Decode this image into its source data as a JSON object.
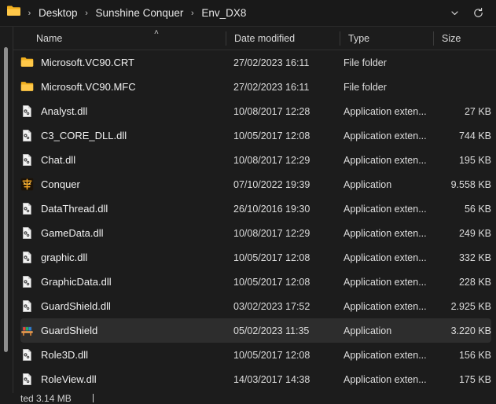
{
  "window": {
    "background_color": "#1c1c1c",
    "selection_color": "#2d2d2d",
    "folder_icon_color": "#ffc849"
  },
  "addressbar": {
    "folder_icon": "folder-icon",
    "crumbs": [
      {
        "label": "Desktop"
      },
      {
        "label": "Sunshine Conquer"
      },
      {
        "label": "Env_DX8"
      }
    ],
    "separator": "›",
    "dropdown_icon": "chevron-down-icon",
    "refresh_icon": "refresh-icon"
  },
  "columns": {
    "name": "Name",
    "date_modified": "Date modified",
    "type": "Type",
    "size": "Size",
    "sort_indicator": "˄",
    "sort_order": "ascending",
    "sorted_by": "Name"
  },
  "files": [
    {
      "name": "Microsoft.VC90.CRT",
      "date": "27/02/2023 16:11",
      "type": "File folder",
      "size": "",
      "icon": "folder-icon",
      "selected": false
    },
    {
      "name": "Microsoft.VC90.MFC",
      "date": "27/02/2023 16:11",
      "type": "File folder",
      "size": "",
      "icon": "folder-icon",
      "selected": false
    },
    {
      "name": "Analyst.dll",
      "date": "10/08/2017 12:28",
      "type": "Application exten...",
      "size": "27 KB",
      "icon": "dll-icon",
      "selected": false
    },
    {
      "name": "C3_CORE_DLL.dll",
      "date": "10/05/2017 12:08",
      "type": "Application exten...",
      "size": "744 KB",
      "icon": "dll-icon",
      "selected": false
    },
    {
      "name": "Chat.dll",
      "date": "10/08/2017 12:29",
      "type": "Application exten...",
      "size": "195 KB",
      "icon": "dll-icon",
      "selected": false
    },
    {
      "name": "Conquer",
      "date": "07/10/2022 19:39",
      "type": "Application",
      "size": "9.558 KB",
      "icon": "conquer-app-icon",
      "selected": false
    },
    {
      "name": "DataThread.dll",
      "date": "26/10/2016 19:30",
      "type": "Application exten...",
      "size": "56 KB",
      "icon": "dll-icon",
      "selected": false
    },
    {
      "name": "GameData.dll",
      "date": "10/08/2017 12:29",
      "type": "Application exten...",
      "size": "249 KB",
      "icon": "dll-icon",
      "selected": false
    },
    {
      "name": "graphic.dll",
      "date": "10/05/2017 12:08",
      "type": "Application exten...",
      "size": "332 KB",
      "icon": "dll-icon",
      "selected": false
    },
    {
      "name": "GraphicData.dll",
      "date": "10/05/2017 12:08",
      "type": "Application exten...",
      "size": "228 KB",
      "icon": "dll-icon",
      "selected": false
    },
    {
      "name": "GuardShield.dll",
      "date": "03/02/2023 17:52",
      "type": "Application exten...",
      "size": "2.925 KB",
      "icon": "dll-icon",
      "selected": false
    },
    {
      "name": "GuardShield",
      "date": "05/02/2023 11:35",
      "type": "Application",
      "size": "3.220 KB",
      "icon": "guardshield-app-icon",
      "selected": true
    },
    {
      "name": "Role3D.dll",
      "date": "10/05/2017 12:08",
      "type": "Application exten...",
      "size": "156 KB",
      "icon": "dll-icon",
      "selected": false
    },
    {
      "name": "RoleView.dll",
      "date": "14/03/2017 14:38",
      "type": "Application exten...",
      "size": "175 KB",
      "icon": "dll-icon",
      "selected": false
    }
  ],
  "statusbar": {
    "text": "ted 3.14 MB"
  }
}
